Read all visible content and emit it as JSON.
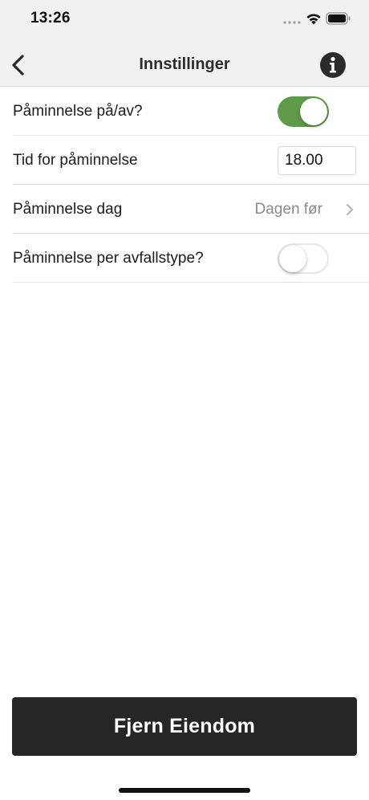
{
  "status_bar": {
    "time": "13:26"
  },
  "nav": {
    "title": "Innstillinger",
    "back_icon": "chevron-left-icon",
    "info_icon": "info-icon"
  },
  "settings": {
    "reminder_toggle": {
      "label": "Påminnelse på/av?",
      "on": true
    },
    "reminder_time": {
      "label": "Tid for påminnelse",
      "value": "18.00"
    },
    "reminder_day": {
      "label": "Påminnelse dag",
      "value": "Dagen før"
    },
    "per_waste_type": {
      "label": "Påminnelse per avfallstype?",
      "on": false
    }
  },
  "actions": {
    "remove_property_label": "Fjern Eiendom"
  },
  "colors": {
    "toggle_on": "#5e9a48",
    "button_bg": "#262626",
    "header_bg": "#f1f1f1"
  }
}
